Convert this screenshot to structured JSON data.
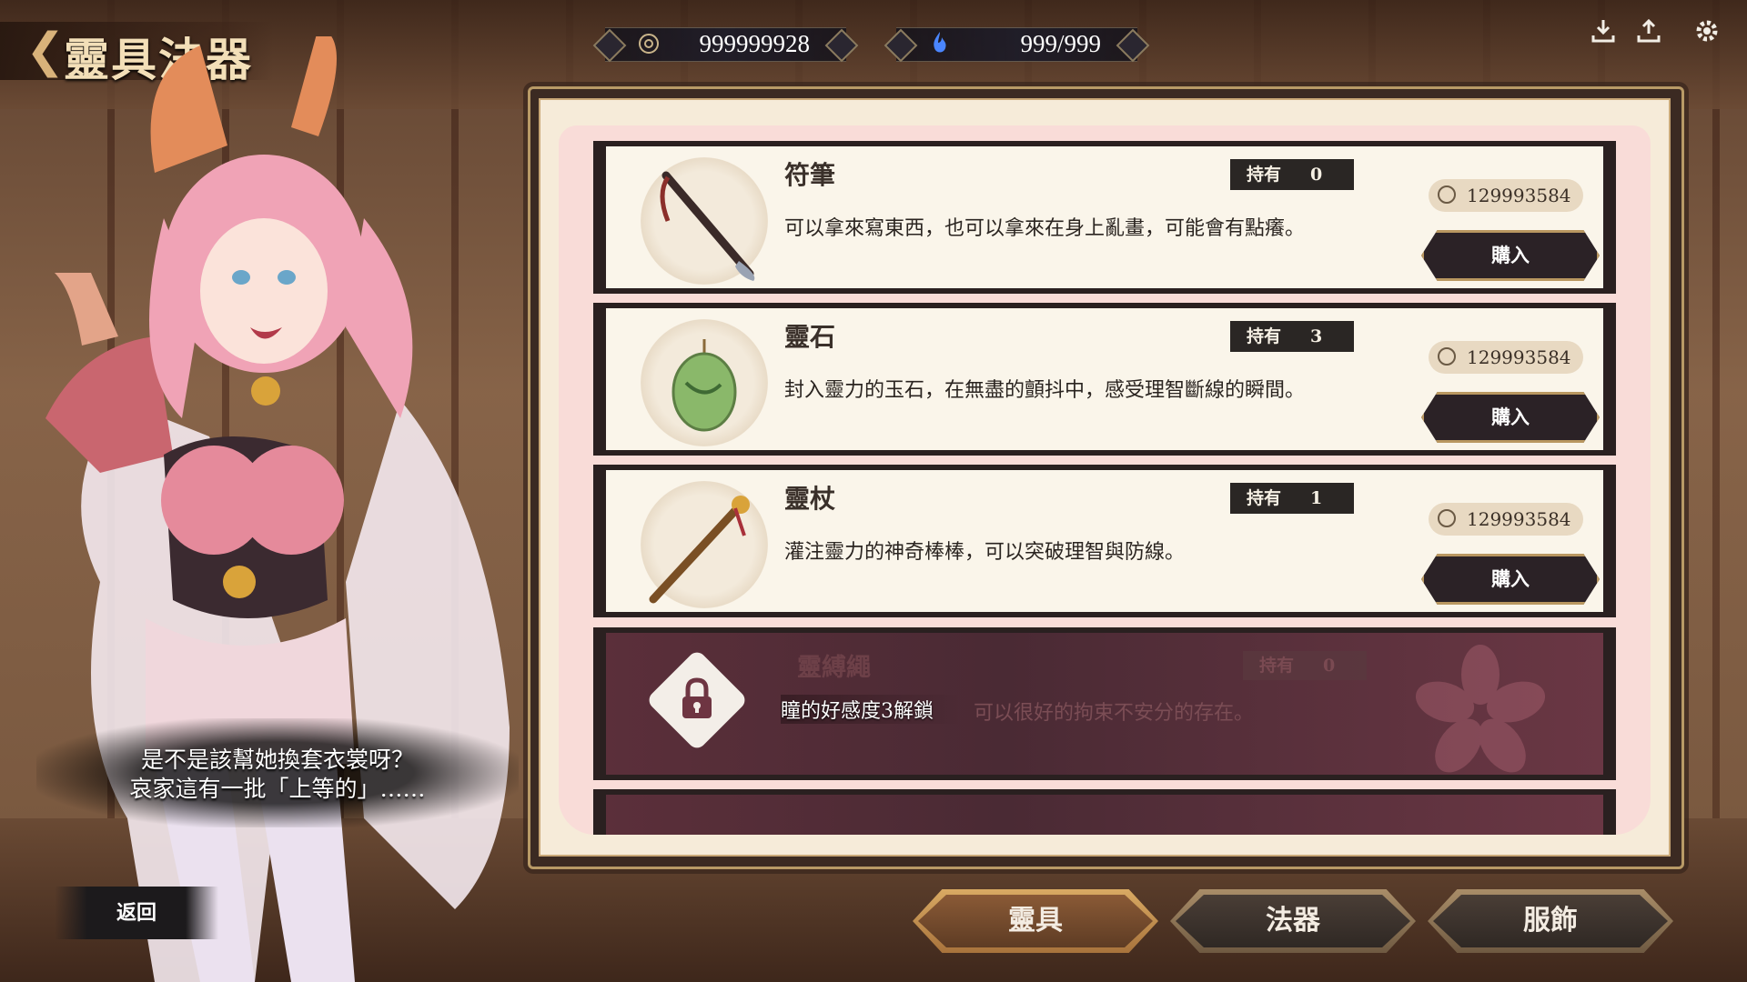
{
  "header": {
    "title": "靈具法器",
    "coins": "999999928",
    "spirit": "999/999"
  },
  "dialog": {
    "line1": "是不是該幫她換套衣裳呀？",
    "line2": "哀家這有一批「上等的」……"
  },
  "back_label": "返回",
  "items": [
    {
      "name": "符筆",
      "owned_label": "持有",
      "owned": "0",
      "desc": "可以拿來寫東西，也可以拿來在身上亂畫，可能會有點癢。",
      "price": "129993584",
      "buy_label": "購入"
    },
    {
      "name": "靈石",
      "owned_label": "持有",
      "owned": "3",
      "desc": "封入靈力的玉石，在無盡的顫抖中，感受理智斷線的瞬間。",
      "price": "129993584",
      "buy_label": "購入"
    },
    {
      "name": "靈杖",
      "owned_label": "持有",
      "owned": "1",
      "desc": "灌注靈力的神奇棒棒，可以突破理智與防線。",
      "price": "129993584",
      "buy_label": "購入"
    }
  ],
  "locked_item": {
    "name": "靈縛繩",
    "owned_label": "持有",
    "owned": "0",
    "unlock_msg": "瞳的好感度3解鎖",
    "desc": "可以很好的拘束不安分的存在。"
  },
  "tabs": [
    {
      "label": "靈具"
    },
    {
      "label": "法器"
    },
    {
      "label": "服飾"
    }
  ],
  "icons": {
    "download": "download-icon",
    "upload": "upload-icon",
    "settings": "gear-icon"
  },
  "colors": {
    "panel_bg": "#f6ebd9",
    "buy_border": "#b99760",
    "active_tab": "#d9aa63"
  }
}
